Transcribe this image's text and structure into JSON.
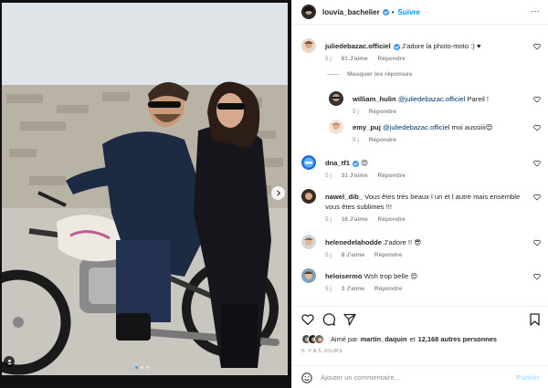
{
  "post": {
    "author": "louvia_bachelier",
    "follow_label": "Suivre",
    "more_label": "···"
  },
  "comments": [
    {
      "user": "juliedebazac.officiel",
      "verified": true,
      "text": "J'adore la photo-moto :) ♥",
      "time": "5 j",
      "likes": "61 J'aime",
      "reply": "Répondre"
    },
    {
      "user": "william_hulin",
      "mention": "@juliedebazac.officiel",
      "text": "Pareil !",
      "time": "5 j",
      "reply": "Répondre"
    },
    {
      "user": "emy_puj",
      "mention": "@juliedebazac.officiel",
      "text": "moi aussiiii😍",
      "time": "5 j",
      "reply": "Répondre"
    },
    {
      "user": "dna_tf1",
      "verified": true,
      "text": "😍",
      "time": "5 j",
      "likes": "31 J'aime",
      "reply": "Répondre"
    },
    {
      "user": "nawel_dib_",
      "text": "Vous êtes très beaux l un et l autre mais ensemble vous êtes sublimes !!!",
      "time": "5 j",
      "likes": "16 J'aime",
      "reply": "Répondre"
    },
    {
      "user": "helenedelahodde",
      "text": "J'adore !! 😎",
      "time": "5 j",
      "likes": "8 J'aime",
      "reply": "Répondre"
    },
    {
      "user": "heloisermo",
      "text": "Wsh trop belle 😍",
      "time": "5 j",
      "likes": "3 J'aime",
      "reply": "Répondre"
    }
  ],
  "hide_replies": "Masquer les réponses",
  "likes_line": {
    "prefix": "Aimé par",
    "user": "martin_daquin",
    "mid": "et",
    "count": "12,168 autres personnes"
  },
  "timestamp": "IL Y A 5 JOURS",
  "add_comment": {
    "placeholder": "Ajouter un commentaire...",
    "post_label": "Publier"
  },
  "colors": {
    "accent": "#0095f6",
    "verified": "#3897f0",
    "muted": "#8e8e8e"
  }
}
